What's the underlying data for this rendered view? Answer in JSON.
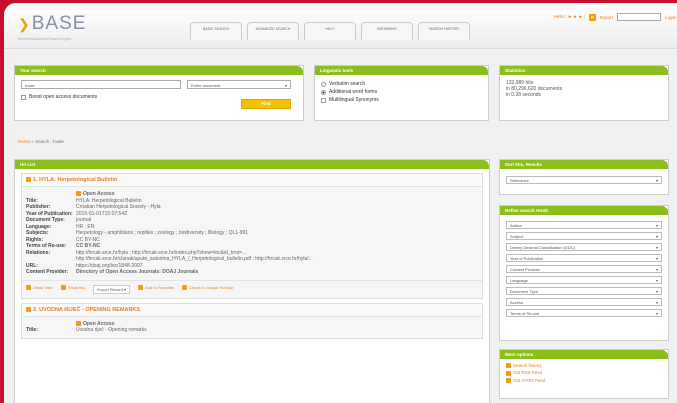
{
  "header": {
    "logo_text": "BASE",
    "logo_sub": "Bielefeld Academic Search Engine",
    "tabs": [
      "BASIC SEARCH",
      "ADVANCED SEARCH",
      "HELP",
      "BROWSING",
      "SEARCH HISTORY"
    ],
    "top_links": "Hello ! ★ ★ ★ |",
    "top_badge": "R",
    "top_link2": "Export",
    "top_select": "",
    "top_login": "Login"
  },
  "search": {
    "head": "Your search",
    "query": "hvale",
    "scope": "Entire document",
    "boost_label": "Boost open access documents",
    "find_button": "Find"
  },
  "linguistic": {
    "head": "Linguistic tools",
    "options": [
      "Verbatim search",
      "Additional word forms",
      "Multilingual Synonyms"
    ]
  },
  "statistics": {
    "head": "Statistics",
    "lines": [
      "133,989 hits",
      "in 80,296,620 documents",
      "in 0.28 seconds"
    ]
  },
  "breadcrumb": {
    "home": "Home",
    "sep": "»",
    "current": "Search : hvale"
  },
  "hitlist": {
    "head": "Hit List",
    "records": [
      {
        "title": "1. HYLA: Herpetological Bulletin",
        "fields": [
          {
            "k": "",
            "v": "Open Access",
            "oa": true
          },
          {
            "k": "Title:",
            "v": "HYLA: Herpetological Bulletin"
          },
          {
            "k": "Publisher:",
            "v": "Croatian Herpetological Society - Hyla"
          },
          {
            "k": "Year of Publication:",
            "v": "2015-01-01T15:07:54Z"
          },
          {
            "k": "Document Type:",
            "v": "journal"
          },
          {
            "k": "Language:",
            "v": "HR ; EN"
          },
          {
            "k": "Subjects:",
            "v": "Herpetology - amphibians ; reptiles ; zoology ; biodiversity ; Biology ; QL1-991"
          },
          {
            "k": "Rights:",
            "v": "CC BY-NC"
          },
          {
            "k": "Terms of Re-use:",
            "v": "CC BY-NC"
          },
          {
            "k": "Relations:",
            "v": "http://hrcak.srce.hr/hyla ; http://hrcak.srce.hr/index.php?show=toc&id_broj=..."
          },
          {
            "k": "",
            "v": "http://hrcak.srce.hr/clanak/upute_autorima_HYLA_/_Herpetological_bulletin.pdf ; http://hrcak.srce.hr/hyla/..."
          },
          {
            "k": "URL:",
            "v": "https://doaj.org/toc/1848-2007"
          },
          {
            "k": "Content Provider:",
            "v": "Directory of Open Access Journals: DOAJ Journals"
          }
        ],
        "actions": [
          "Detail View",
          "Email this",
          "Export Record",
          "Add to Favorites",
          "Check in Google Scholar"
        ]
      },
      {
        "title": "2. UVODNA RIJEČ - OPENING REMARKS",
        "fields": [
          {
            "k": "",
            "v": "Open Access",
            "oa": true
          },
          {
            "k": "Title:",
            "v": "Uvodna riječ - Opening remarks"
          }
        ],
        "actions": []
      }
    ]
  },
  "sidebar": {
    "sort_head": "Sort hits, Results",
    "sort_value": "Relevance",
    "refine_head": "Refine search result",
    "facets": [
      "Author",
      "Subject",
      "Dewey Decimal Classification (DDC)",
      "Year of Publication",
      "Content Provider",
      "Language",
      "Document Type",
      "Access",
      "Terms of Re-use"
    ],
    "more_head": "More options",
    "more_links": [
      "Search history",
      "Get RSS Feed",
      "Get ATOM Feed"
    ]
  }
}
